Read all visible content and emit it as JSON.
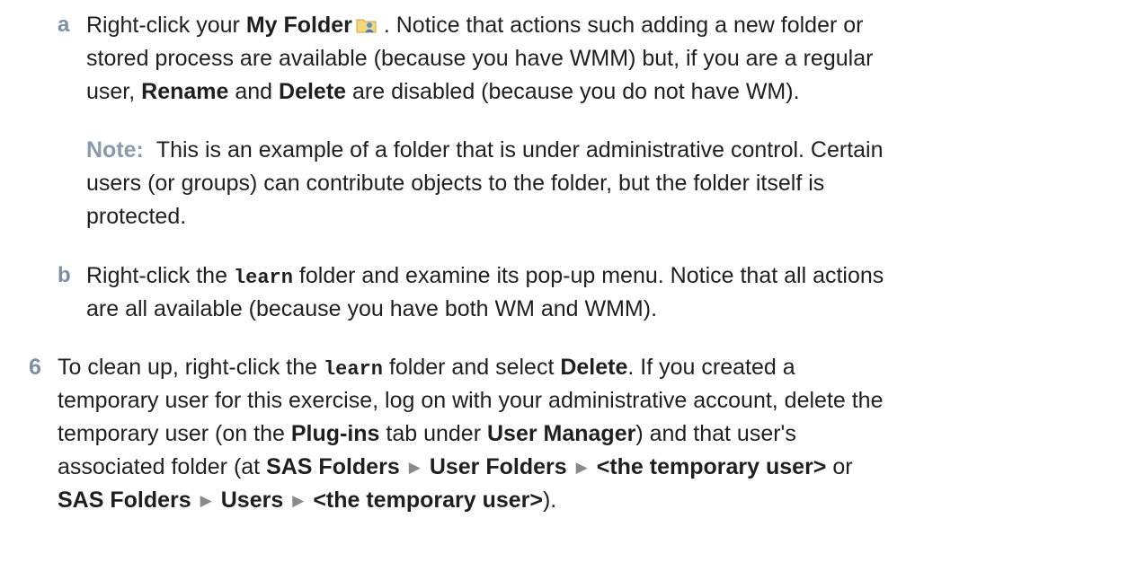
{
  "step5": {
    "a": {
      "marker": "a",
      "l1_pre": "Right-click your ",
      "l1_bold": "My Folder",
      "l1_post": " . Notice that actions such adding a new folder or",
      "l2": "stored process are available (because you have WMM) but, if you are a regular",
      "l3_pre": "user, ",
      "l3_b1": "Rename",
      "l3_mid": " and ",
      "l3_b2": "Delete",
      "l3_post": " are disabled (because you do not have WM).",
      "note_label": "Note:",
      "note_l1": "This is an example of a folder that is under administrative control. Certain",
      "note_l2": "users (or groups) can contribute objects to the folder, but the folder itself is",
      "note_l3": "protected."
    },
    "b": {
      "marker": "b",
      "l1_pre": "Right-click the ",
      "l1_code": "learn",
      "l1_post": " folder and examine its pop-up menu. Notice that all actions",
      "l2": "are all available (because you have both WM and WMM)."
    }
  },
  "step6": {
    "number": "6",
    "l1_pre": "To clean up, right-click the ",
    "l1_code": "learn",
    "l1_mid": " folder and select ",
    "l1_bold": "Delete",
    "l1_post": ". If you created a",
    "l2": "temporary user for this exercise, log on with your administrative account, delete the",
    "l3_pre": "temporary user (on the ",
    "l3_b1": "Plug-ins",
    "l3_mid": " tab under ",
    "l3_b2": "User Manager",
    "l3_post": ") and that user's",
    "l4_pre": "associated folder (at ",
    "l4_b1": "SAS Folders",
    "l4_b2": "User Folders",
    "l4_b3": "<the temporary user>",
    "l4_post": " or",
    "l5_b1": "SAS Folders",
    "l5_b2": "Users",
    "l5_b3": "<the temporary user>",
    "l5_post": ").",
    "arrow": "▶"
  },
  "icons": {
    "folder": "user-folder-icon"
  }
}
